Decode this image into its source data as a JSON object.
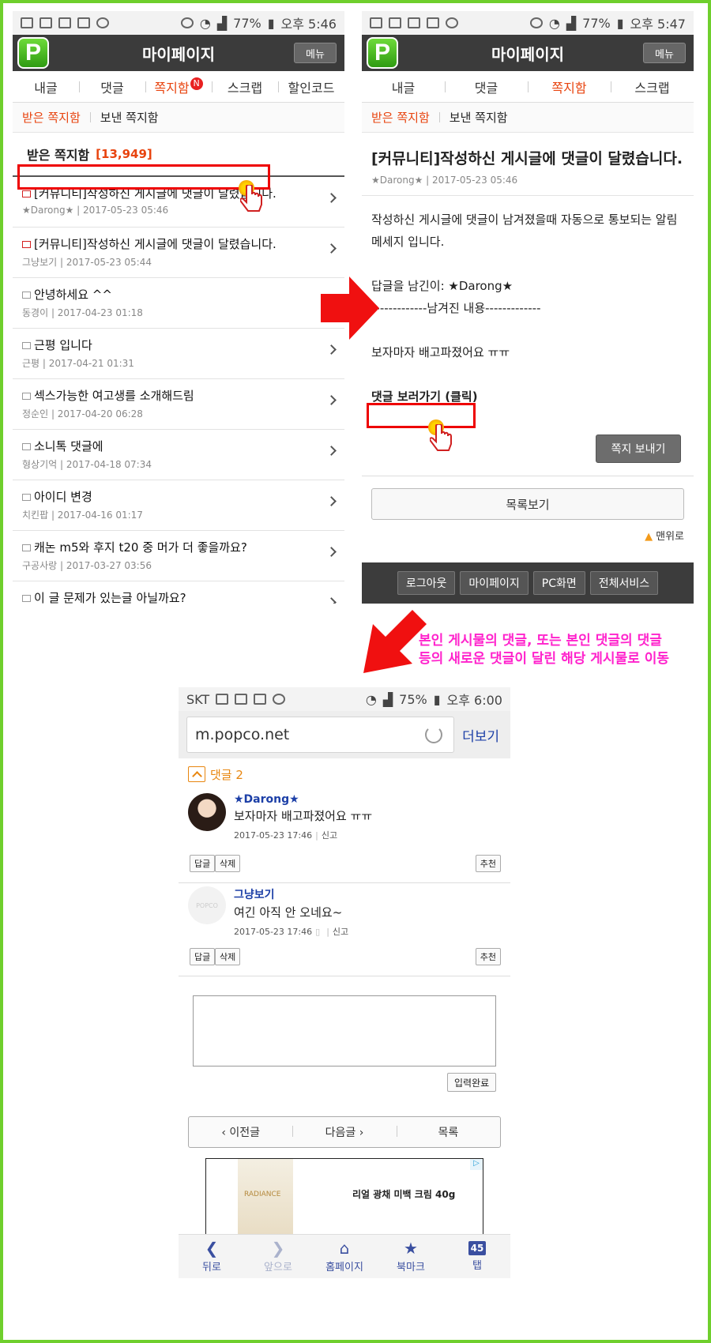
{
  "colors": {
    "accent": "#e8440f",
    "frame": "#6fcf2d",
    "highlight": "#ee0000",
    "annotation": "#ff22cc",
    "link": "#1c3fa7"
  },
  "phone1": {
    "status": {
      "battery": "77%",
      "time": "오후 5:46"
    },
    "logo": "P",
    "title": "마이페이지",
    "menu": "메뉴",
    "tabs": [
      "내글",
      "댓글",
      "쪽지함",
      "스크랩",
      "할인코드"
    ],
    "new_badge": "N",
    "subtabs": [
      "받은 쪽지함",
      "보낸 쪽지함"
    ],
    "inbox_title": "받은 쪽지함",
    "inbox_count": "[13,949]",
    "messages": [
      {
        "title": "[커뮤니티]작성하신 게시글에 댓글이 달렸습니다.",
        "author": "★Darong★",
        "date": "2017-05-23 05:46",
        "unread": true
      },
      {
        "title": "[커뮤니티]작성하신 게시글에 댓글이 달렸습니다.",
        "author": "그냥보기",
        "date": "2017-05-23 05:44",
        "unread": true
      },
      {
        "title": "안녕하세요 ^^",
        "author": "동경이",
        "date": "2017-04-23 01:18",
        "unread": false
      },
      {
        "title": "근평 입니다",
        "author": "근평",
        "date": "2017-04-21 01:31",
        "unread": false
      },
      {
        "title": "섹스가능한 여고생를 소개해드림",
        "author": "정순인",
        "date": "2017-04-20 06:28",
        "unread": false
      },
      {
        "title": "소니톡 댓글에",
        "author": "형상기억",
        "date": "2017-04-18 07:34",
        "unread": false
      },
      {
        "title": "아이디 변경",
        "author": "치킨팝",
        "date": "2017-04-16 01:17",
        "unread": false
      },
      {
        "title": "캐논 m5와 후지 t20 중 머가 더 좋을까요?",
        "author": "구공사랑",
        "date": "2017-03-27 03:56",
        "unread": false
      },
      {
        "title": "이 글 문제가 있는글 아닐까요?",
        "author": "",
        "date": "",
        "unread": false
      }
    ]
  },
  "phone2": {
    "status": {
      "battery": "77%",
      "time": "오후 5:47"
    },
    "logo": "P",
    "title": "마이페이지",
    "menu": "메뉴",
    "tabs": [
      "내글",
      "댓글",
      "쪽지함",
      "스크랩"
    ],
    "subtabs": [
      "받은 쪽지함",
      "보낸 쪽지함"
    ],
    "message": {
      "title": "[커뮤니티]작성하신 게시글에 댓글이 달렸습니다.",
      "meta": "★Darong★ | 2017-05-23 05:46",
      "body": [
        "작성하신 게시글에 댓글이 남겨졌을때 자동으로 통보되는 알림 메세지 입니다.",
        "",
        "답글을 남긴이: ★Darong★",
        "-------------남겨진 내용-------------",
        "",
        "보자마자 배고파졌어요 ㅠㅠ",
        ""
      ],
      "link": "댓글 보러가기 (클릭)"
    },
    "send_button": "쪽지 보내기",
    "list_button": "목록보기",
    "to_top": "맨위로",
    "footer": [
      "로그아웃",
      "마이페이지",
      "PC화면",
      "전체서비스"
    ]
  },
  "annotation": [
    "본인 게시물의 댓글, 또는 본인 댓글의 댓글",
    "등의 새로운 댓글이 달린 해당 게시물로 이동"
  ],
  "phone3": {
    "status": {
      "carrier": "SKT",
      "battery": "75%",
      "time": "오후 6:00"
    },
    "url": "m.popco.net",
    "more": "더보기",
    "comment_header": "댓글 2",
    "comments": [
      {
        "author": "★Darong★",
        "text": "보자마자 배고파졌어요 ㅠㅠ",
        "date": "2017-05-23 17:46",
        "report": "신고",
        "reply": "답글",
        "delete": "삭제",
        "recommend": "추천",
        "avatar_text": ""
      },
      {
        "author": "그냥보기",
        "text": "여긴 아직 안 오네요~",
        "date": "2017-05-23 17:46",
        "report": "신고",
        "reply": "답글",
        "delete": "삭제",
        "recommend": "추천",
        "avatar_text": "POPCO"
      }
    ],
    "submit": "입력완료",
    "post_nav": [
      "이전글",
      "다음글",
      "목록"
    ],
    "ad": {
      "brand": "RADIANCE",
      "text": "리얼 광채 미백 크림 40g"
    },
    "navbar": [
      "뒤로",
      "앞으로",
      "홈페이지",
      "북마크",
      "탭"
    ],
    "tab_count": "45"
  }
}
